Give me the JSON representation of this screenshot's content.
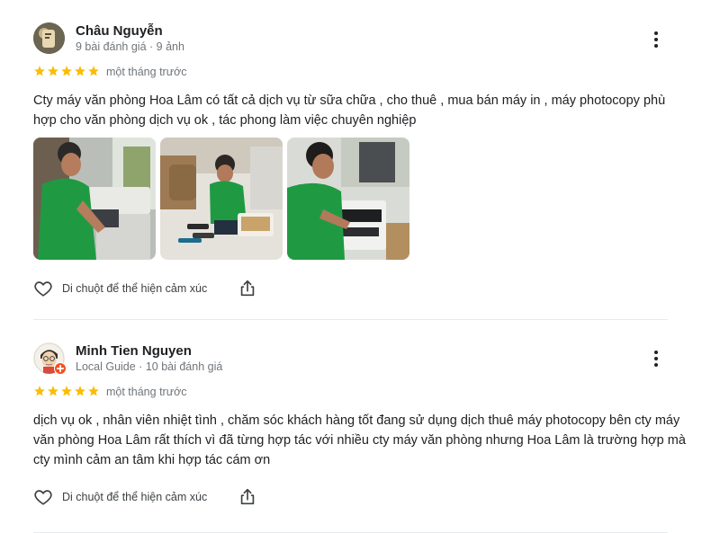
{
  "reviews": [
    {
      "name": "Châu Nguyễn",
      "meta": "9 bài đánh giá · 9 ảnh",
      "rating": 5,
      "time": "một tháng trước",
      "text": "Cty máy văn phòng Hoa Lâm có tất cả dịch vụ từ sữa chữa , cho thuê , mua bán máy in , máy photocopy phù hợp cho văn phòng dịch vụ ok , tác phong làm việc chuyên nghiệp",
      "like_label": "Di chuột để thể hiện cảm xúc",
      "photo_count": 3
    },
    {
      "name": "Minh Tien Nguyen",
      "meta": "Local Guide · 10 bài đánh giá",
      "rating": 5,
      "time": "một tháng trước",
      "text": "dịch vụ ok , nhân viên nhiệt tình , chăm sóc khách hàng tốt đang sử dụng dịch thuê máy photocopy bên cty máy văn phòng Hoa Lâm rất thích vì đã từng hợp tác với nhiều cty máy văn phòng nhưng Hoa Lâm là trường hợp mà cty mình cảm an tâm khi hợp tác cám ơn",
      "like_label": "Di chuột để thể hiện cảm xúc"
    }
  ],
  "icons": {
    "star": "star-icon",
    "more": "more-vert-icon",
    "like": "heart-outline-icon",
    "share": "share-icon",
    "local_guide_badge": "local-guide-badge-icon"
  },
  "colors": {
    "star": "#fbbc04",
    "text": "#202124",
    "secondary": "#70757a",
    "badge": "#f4511e",
    "divider": "#e8eaed"
  }
}
